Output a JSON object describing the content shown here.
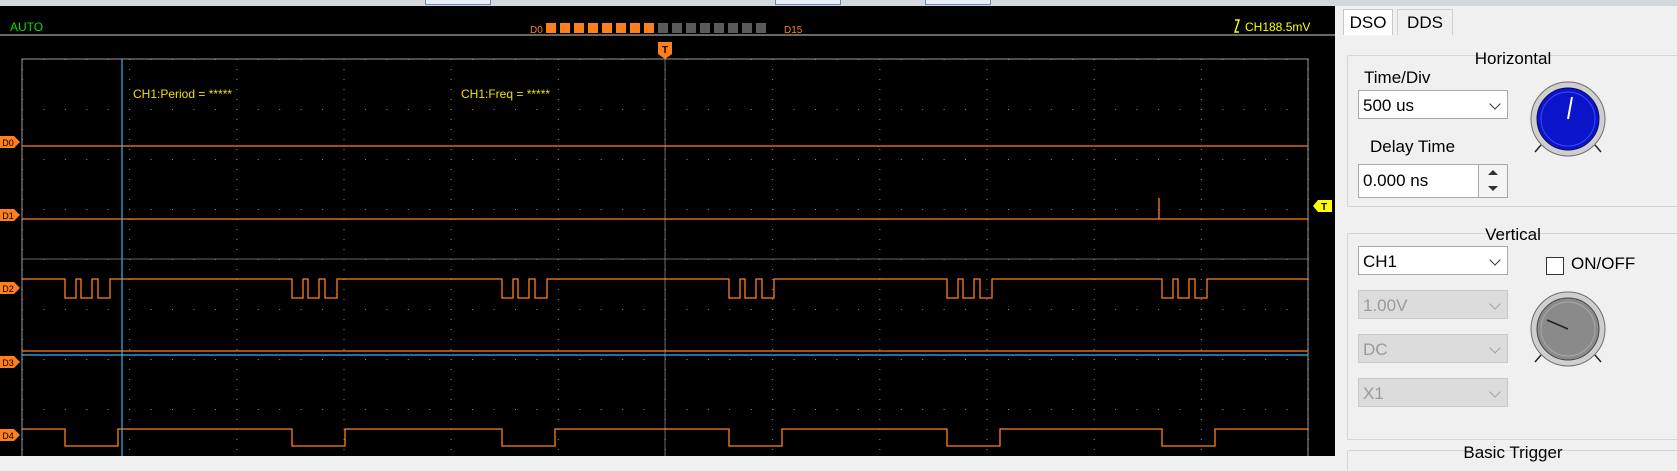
{
  "scope": {
    "mode": "AUTO",
    "digital_start": "D0",
    "digital_end": "D15",
    "digital_active_count": 8,
    "digital_total": 16,
    "trigger_readout": "CH188.5mV",
    "trigger_marker": "T",
    "channel_markers": [
      "D0",
      "D1",
      "D2",
      "D3",
      "D4"
    ],
    "measure_period": "CH1:Period = *****",
    "measure_freq": "CH1:Freq = *****",
    "colors": {
      "background": "#000000",
      "trace": "#ff7f1e",
      "cursor": "#3ab0e8",
      "measure_text": "#f0e000",
      "mode_text": "#00e000",
      "trigger_text": "#ffff00",
      "grid_dot": "#8c8c8c"
    }
  },
  "panel": {
    "tabs": [
      "DSO",
      "DDS"
    ],
    "horizontal": {
      "title": "Horizontal",
      "timediv_label": "Time/Div",
      "timediv_value": "500 us",
      "delay_label": "Delay Time",
      "delay_value": "0.000 ns"
    },
    "vertical": {
      "title": "Vertical",
      "channel_value": "CH1",
      "onoff_label": "ON/OFF",
      "volts_value": "1.00V",
      "coupling_value": "DC",
      "probe_value": "X1"
    },
    "trigger": {
      "title": "Basic Trigger"
    },
    "colors": {
      "knob_blue": "#0a14c8",
      "knob_gray": "#8a8a8a"
    }
  }
}
